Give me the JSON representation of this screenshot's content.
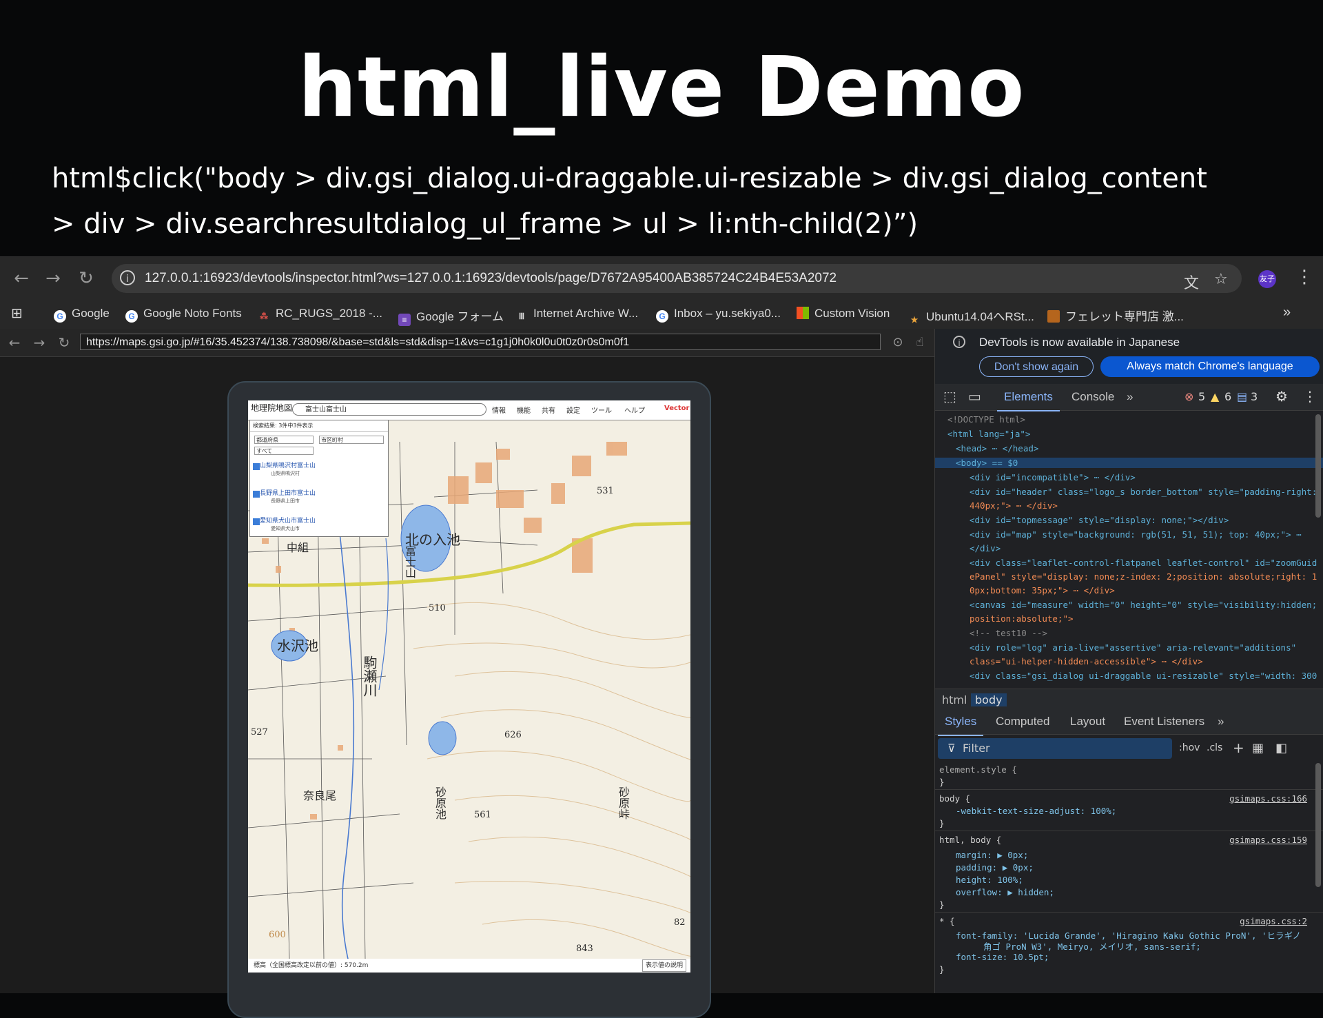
{
  "slide": {
    "title": "html_live Demo",
    "code_line1": "html$click(\"body > div.gsi_dialog.ui-draggable.ui-resizable > div.gsi_dialog_content",
    "code_line2": "> div > div.searchresultdialog_ul_frame > ul > li:nth-child(2)”)"
  },
  "browser": {
    "address": "127.0.0.1:16923/devtools/inspector.html?ws=127.0.0.1:16923/devtools/page/D7672A95400AB385724C24B4E53A2072",
    "avatar_label": "友子",
    "bookmarks": [
      {
        "label": "Google",
        "icon": "google-icon"
      },
      {
        "label": "Google Noto Fonts",
        "icon": "google-icon"
      },
      {
        "label": "RC_RUGS_2018 -...",
        "icon": "dots-icon"
      },
      {
        "label": "Google フォーム",
        "icon": "forms-icon"
      },
      {
        "label": "Internet Archive W...",
        "icon": "archive-icon"
      },
      {
        "label": "Inbox – yu.sekiya0...",
        "icon": "google-icon"
      },
      {
        "label": "Custom Vision",
        "icon": "microsoft-icon"
      },
      {
        "label": "Ubuntu14.04へRSt...",
        "icon": "star-icon"
      },
      {
        "label": "フェレット専門店 激...",
        "icon": "shop-icon"
      }
    ]
  },
  "page": {
    "url": "https://maps.gsi.go.jp/#16/35.452374/138.738098/&base=std&ls=std&disp=1&vs=c1g1j0h0k0l0u0t0z0r0s0m0f1"
  },
  "map": {
    "logo": "地理院地図",
    "search_value": "富士山富士山",
    "vector_badge": "Vector",
    "toolbar": [
      "情報",
      "機能",
      "共有",
      "設定",
      "ツール",
      "ヘルプ"
    ],
    "dialog": {
      "header": "検索結果: 3件中3件表示",
      "select1": "都道府県",
      "select2": "市区町村",
      "select3": "すべて",
      "results": [
        {
          "name": "山梨県鳴沢村富士山",
          "sub": "山梨県鳴沢村"
        },
        {
          "name": "長野県上田市富士山",
          "sub": "長野県上田市"
        },
        {
          "name": "愛知県犬山市富士山",
          "sub": "愛知県犬山市"
        }
      ]
    },
    "labels": [
      "北の入池",
      "富士山",
      "中組",
      "水沢池",
      "駒瀬川",
      "奈良尾",
      "砂原池",
      "砂原峠",
      "531",
      "510",
      "527",
      "626",
      "561",
      "843",
      "600",
      "82"
    ],
    "elevation_text": "標高（全国標高改定以前の値）: 570.2m",
    "legend_button": "表示値の説明"
  },
  "devtools": {
    "notice": "DevTools is now available in Japanese",
    "btn_dont_show": "Don't show again",
    "btn_match": "Always match Chrome's language",
    "tabs": [
      "Elements",
      "Console"
    ],
    "errors": "5",
    "warnings": "6",
    "messages": "3",
    "dom": [
      "<!DOCTYPE html>",
      "<html lang=\"ja\">",
      "<head> ⋯ </head>",
      "<body> == $0",
      "<div id=\"incompatible\"> ⋯ </div>",
      "<div id=\"header\" class=\"logo_s border_bottom\" style=\"padding-right:",
      "440px;\"> ⋯ </div>",
      "<div id=\"topmessage\" style=\"display: none;\"></div>",
      "<div id=\"map\" style=\"background: rgb(51, 51, 51); top: 40px;\"> ⋯",
      "</div>",
      "<div class=\"leaflet-control-flatpanel leaflet-control\" id=\"zoomGuid",
      "ePanel\" style=\"display: none;z-index: 2;position: absolute;right: 1",
      "0px;bottom: 35px;\"> ⋯ </div>",
      "<canvas id=\"measure\" width=\"0\" height=\"0\" style=\"visibility:hidden;",
      "position:absolute;\">",
      "<!-- test10 -->",
      "<div role=\"log\" aria-live=\"assertive\" aria-relevant=\"additions\"",
      "class=\"ui-helper-hidden-accessible\"> ⋯ </div>",
      "<div class=\"gsi_dialog ui-draggable ui-resizable\" style=\"width: 300"
    ],
    "breadcrumbs": [
      "html",
      "body"
    ],
    "subtabs": [
      "Styles",
      "Computed",
      "Layout",
      "Event Listeners"
    ],
    "filter_placeholder": "Filter",
    "filter_opts": [
      ":hov",
      ".cls"
    ],
    "styles": [
      "element.style {",
      "}",
      "body {",
      "-webkit-text-size-adjust: 100%;",
      "}",
      "html, body {",
      "margin: ▶ 0px;",
      "padding: ▶ 0px;",
      "height: 100%;",
      "overflow: ▶ hidden;",
      "}",
      "* {",
      "font-family: 'Lucida Grande', 'Hiragino Kaku Gothic ProN', 'ヒラギノ",
      "角ゴ ProN W3', Meiryo, メイリオ, sans-serif;",
      "font-size: 10.5pt;",
      "}"
    ],
    "style_sources": [
      "gsimaps.css:166",
      "gsimaps.css:159",
      "gsimaps.css:2"
    ]
  }
}
